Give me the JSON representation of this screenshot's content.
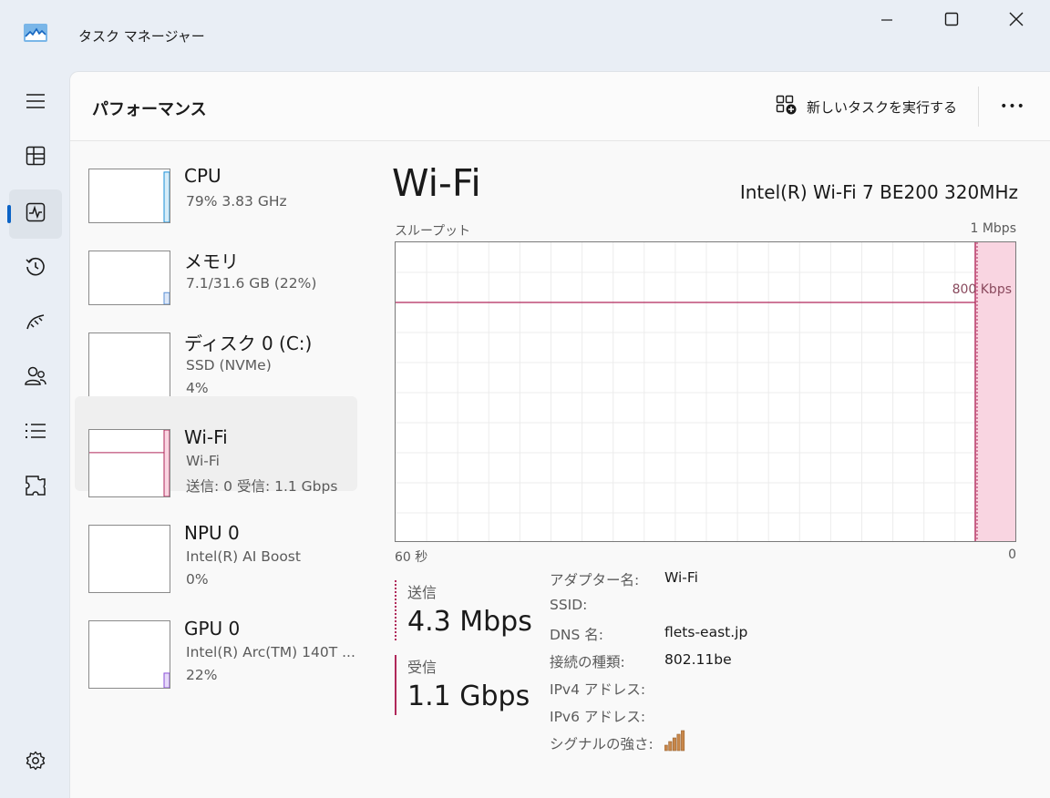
{
  "window": {
    "title": "タスク マネージャー",
    "buttons": {
      "minimize": "minimize-icon",
      "maximize": "maximize-icon",
      "close": "close-icon"
    }
  },
  "nav_rail": {
    "items": [
      {
        "name": "menu",
        "icon": "hamburger-icon"
      },
      {
        "name": "processes",
        "icon": "processes-icon"
      },
      {
        "name": "performance",
        "icon": "performance-icon",
        "active": true
      },
      {
        "name": "app-history",
        "icon": "history-icon"
      },
      {
        "name": "startup-apps",
        "icon": "startup-icon"
      },
      {
        "name": "users",
        "icon": "users-icon"
      },
      {
        "name": "details",
        "icon": "details-icon"
      },
      {
        "name": "services",
        "icon": "services-icon"
      }
    ],
    "settings_icon": "gear-icon",
    "accent": "#0b63c6"
  },
  "header": {
    "title": "パフォーマンス",
    "run_task_label": "新しいタスクを実行する",
    "more_label": "•••"
  },
  "devices": [
    {
      "name": "CPU",
      "sub1": "79%  3.83 GHz",
      "sub2": "",
      "color": "#1a8fd8",
      "fill": "#d6ecf8"
    },
    {
      "name": "メモリ",
      "sub1": "7.1/31.6 GB (22%)",
      "sub2": "",
      "color": "#5a8fd6",
      "fill": "#dde8f8"
    },
    {
      "name": "ディスク 0 (C:)",
      "sub1": "SSD (NVMe)",
      "sub2": "4%",
      "color": "#4caf50",
      "fill": "#e3f3e3"
    },
    {
      "name": "Wi-Fi",
      "sub1": "Wi-Fi",
      "sub2": "送信: 0  受信: 1.1 Gbps",
      "color": "#b0285a",
      "fill": "#f9d5e1",
      "selected": true
    },
    {
      "name": "NPU 0",
      "sub1": "Intel(R) AI Boost",
      "sub2": "0%",
      "color": "#1a8fd8",
      "fill": "#d6ecf8"
    },
    {
      "name": "GPU 0",
      "sub1": "Intel(R) Arc(TM) 140T ...",
      "sub2": "22%",
      "color": "#8a4fd8",
      "fill": "#e6d9f8"
    }
  ],
  "detail": {
    "title": "Wi-Fi",
    "adapter": "Intel(R) Wi-Fi 7 BE200 320MHz",
    "graph": {
      "label": "スループット",
      "max_label": "1 Mbps",
      "ref_label": "800 Kbps",
      "ref_fraction": 0.8,
      "x_left": "60 秒",
      "x_right": "0",
      "line_color": "#b0285a",
      "fill_color": "#f9d5e1"
    },
    "send": {
      "label": "送信",
      "value": "4.3 Mbps"
    },
    "recv": {
      "label": "受信",
      "value": "1.1 Gbps"
    },
    "properties": [
      {
        "key": "アダプター名:",
        "value": "Wi-Fi"
      },
      {
        "key": "SSID:",
        "value": ""
      },
      {
        "key": "DNS 名:",
        "value": "flets-east.jp"
      },
      {
        "key": "接続の種類:",
        "value": "802.11be"
      },
      {
        "key": "IPv4 アドレス:",
        "value": ""
      },
      {
        "key": "IPv6 アドレス:",
        "value": ""
      },
      {
        "key": "シグナルの強さ:",
        "value": ""
      }
    ],
    "signal_bars": 5,
    "signal_color": "#c8874a"
  }
}
